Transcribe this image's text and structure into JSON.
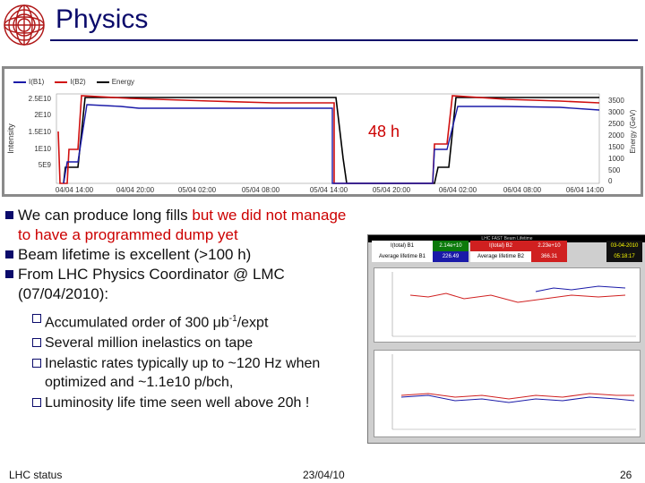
{
  "header": {
    "title": "Physics"
  },
  "top_chart": {
    "legend": [
      "I(B1)",
      "I(B2)",
      "Energy"
    ],
    "y_left_label": "Intensity",
    "y_left_ticks": [
      "5E9",
      "1E10",
      "1.5E10",
      "2E10",
      "2.5E10"
    ],
    "y_right_label": "Energy (GeV)",
    "y_right_ticks": [
      "0",
      "500",
      "1000",
      "1500",
      "2000",
      "2500",
      "3000",
      "3500"
    ],
    "x_ticks": [
      "04/04 14:00",
      "04/04 20:00",
      "05/04 02:00",
      "05/04 08:00",
      "05/04 14:00",
      "05/04 20:00",
      "06/04 02:00",
      "06/04 08:00",
      "06/04 14:00"
    ],
    "annotation": "48 h",
    "colors": {
      "b1": "#1a1aa8",
      "b2": "#d01010",
      "energy": "#000000"
    }
  },
  "bullets": {
    "b1_normal": "We can produce long fills ",
    "b1_red": "but we did not manage to have a programmed dump yet",
    "b2": "Beam lifetime is excellent (>100 h)",
    "b3": "From LHC Physics Coordinator @ LMC (07/04/2010):",
    "s1_pre": "Accumulated order of 300 ",
    "s1_mu": "μ",
    "s1_b": "b",
    "s1_sup": "-1",
    "s1_post": "/expt",
    "s2": "Several million inelastics on tape",
    "s3": "Inelastic rates typically up to ~120 Hz when optimized and ~1.1e10 p/bch,",
    "s4": "Luminosity life time seen well above 20h !"
  },
  "monitor": {
    "title": "LHC FAST Beam Lifetime",
    "r1": [
      "I(total) B1",
      "2.14e+10",
      "I(total) B2",
      "2.23e+10"
    ],
    "r2": [
      "Average lifetime B1",
      "226.49",
      "Average lifetime B2",
      "366.31"
    ],
    "clock": [
      "03-04-2010",
      "05:18:17"
    ]
  },
  "footer": {
    "left": "LHC status",
    "center": "23/04/10",
    "right": "26"
  }
}
